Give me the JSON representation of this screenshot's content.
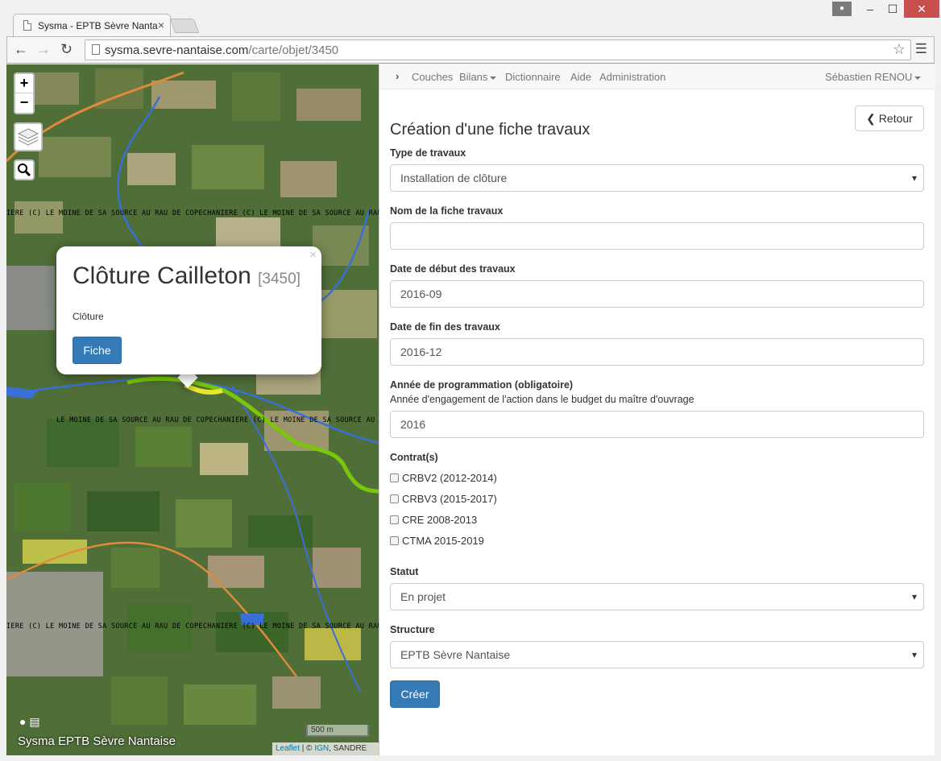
{
  "browser": {
    "tab_title": "Sysma - EPTB Sèvre Nanta",
    "url_host": "sysma.sevre-nantaise.com",
    "url_path": "/carte/objet/3450"
  },
  "map": {
    "zoom_in": "+",
    "zoom_out": "−",
    "labels": [
      "IERE (C)  LE MOINE DE SA SOURCE AU RAU DE COPECHANIERE (C)  LE MOINE DE SA SOURCE AU RAU",
      "LE MOINE DE SA SOURCE AU RAU DE COPECHANIERE (C)  LE MOINE DE SA SOURCE AU RAU",
      "IERE (C)  LE MOINE DE SA SOURCE AU RAU DE COPECHANIERE (C)  LE MOINE DE SA SOURCE AU RAU"
    ],
    "popup": {
      "title": "Clôture Cailleton",
      "id": "[3450]",
      "type": "Clôture",
      "button": "Fiche",
      "close": "×"
    },
    "brand": "Sysma EPTB Sèvre Nantaise",
    "scale": "500 m",
    "attribution": {
      "leaflet": "Leaflet",
      "sep1": " | © ",
      "ign": "IGN",
      "rest": ", SANDRE"
    }
  },
  "nav": {
    "items": [
      "Couches",
      "Bilans",
      "Dictionnaire",
      "Aide",
      "Administration"
    ],
    "user": "Sébastien RENOU"
  },
  "form": {
    "back_button": "Retour",
    "title": "Création d'une fiche travaux",
    "type_label": "Type de travaux",
    "type_value": "Installation de clôture",
    "name_label": "Nom de la fiche travaux",
    "name_value": "",
    "start_label": "Date de début des travaux",
    "start_value": "2016-09",
    "end_label": "Date de fin des travaux",
    "end_value": "2016-12",
    "year_label": "Année de programmation (obligatoire)",
    "year_help": "Année d'engagement de l'action dans le budget du maître d'ouvrage",
    "year_value": "2016",
    "contracts_label": "Contrat(s)",
    "contracts": [
      "CRBV2 (2012-2014)",
      "CRBV3 (2015-2017)",
      "CRE 2008-2013",
      "CTMA 2015-2019"
    ],
    "status_label": "Statut",
    "status_value": "En projet",
    "structure_label": "Structure",
    "structure_value": "EPTB Sèvre Nantaise",
    "submit": "Créer"
  },
  "colors": {
    "primary": "#337ab7",
    "map_river": "#3a6fd8",
    "map_road": "#e08a3c",
    "map_highlight": "#e6e62a",
    "map_selected": "#7ac70a"
  }
}
